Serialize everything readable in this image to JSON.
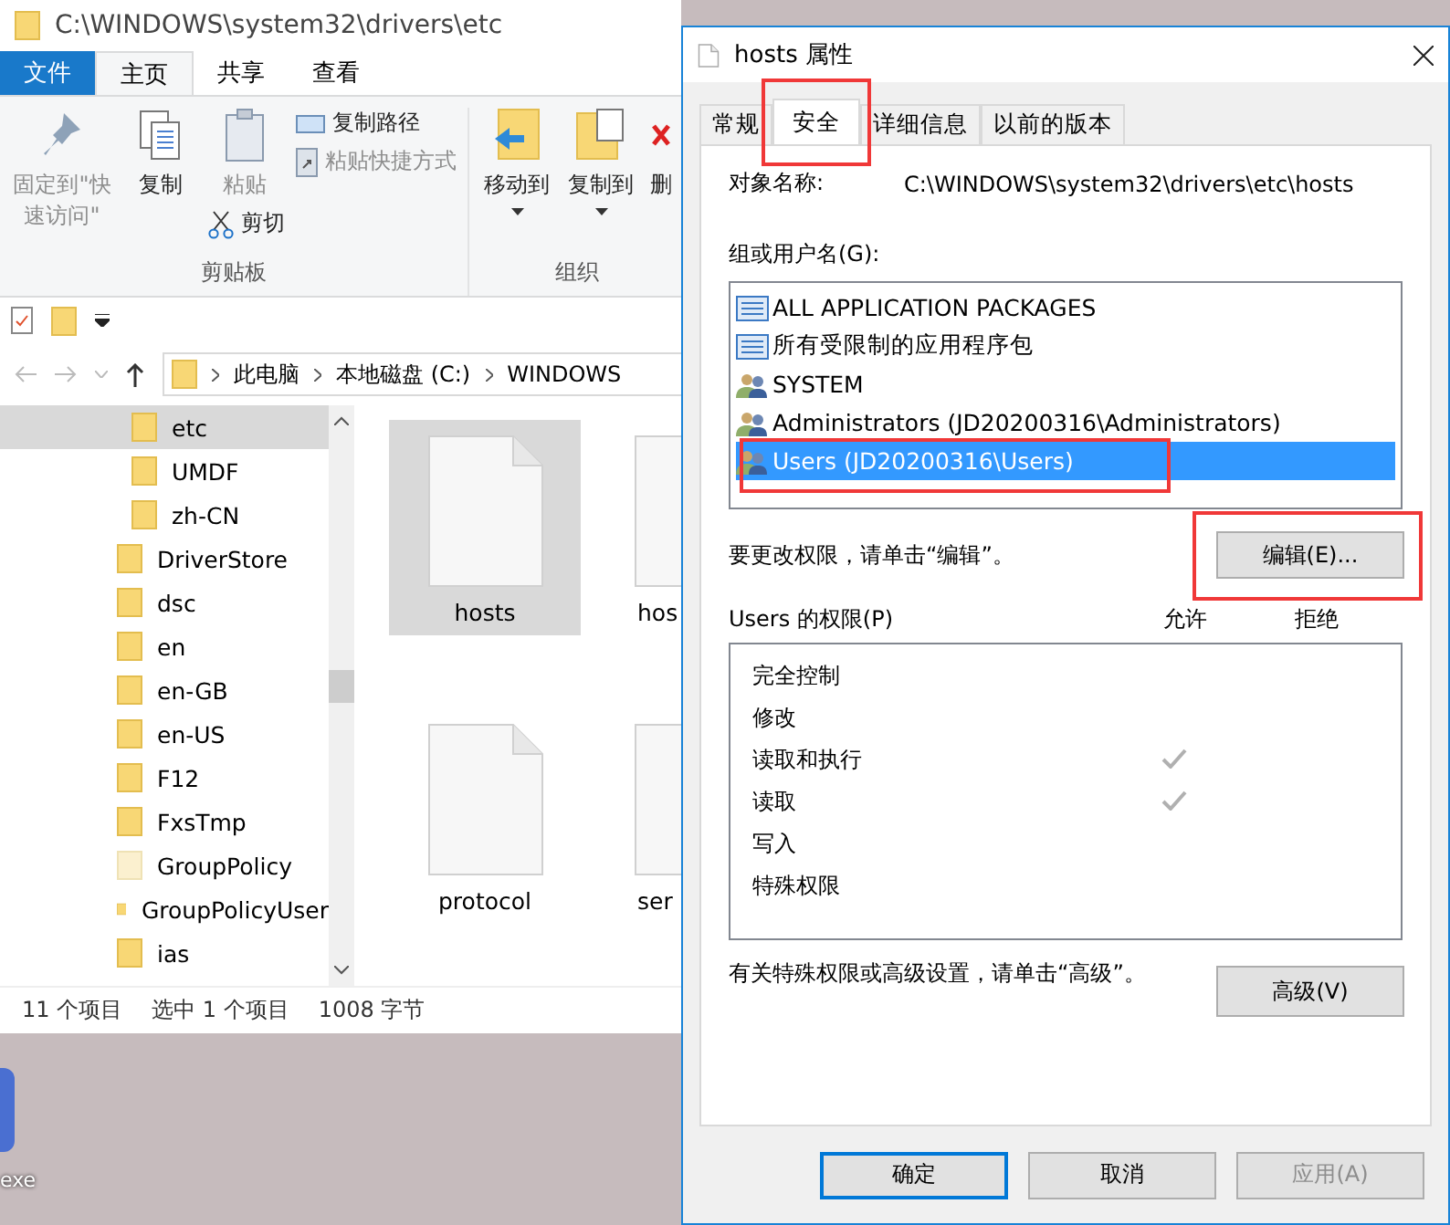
{
  "explorer": {
    "title": "C:\\WINDOWS\\system32\\drivers\\etc",
    "ribbon_tabs": [
      {
        "label": "文件",
        "kind": "file",
        "selected": false
      },
      {
        "label": "主页",
        "kind": "tab",
        "selected": true
      },
      {
        "label": "共享",
        "kind": "tab",
        "selected": false
      },
      {
        "label": "查看",
        "kind": "tab",
        "selected": false
      }
    ],
    "ribbon_groups": [
      {
        "label": "剪贴板",
        "commands": [
          {
            "label": "固定到\"快速访问\"",
            "kind": "pin",
            "disabled": true
          },
          {
            "label": "复制",
            "kind": "copy",
            "disabled": false
          },
          {
            "label": "粘贴",
            "kind": "paste",
            "disabled": true
          },
          {
            "label": "复制路径",
            "kind": "copy-path",
            "disabled": false
          },
          {
            "label": "粘贴快捷方式",
            "kind": "paste-shortcut",
            "disabled": true
          },
          {
            "label": "剪切",
            "kind": "cut",
            "disabled": false
          }
        ]
      },
      {
        "label": "组织",
        "commands": [
          {
            "label": "移动到",
            "kind": "move-to",
            "disabled": false
          },
          {
            "label": "复制到",
            "kind": "copy-to",
            "disabled": false
          },
          {
            "label": "删",
            "kind": "delete",
            "disabled": false
          }
        ]
      }
    ],
    "breadcrumb": [
      "此电脑",
      "本地磁盘 (C:)",
      "WINDOWS"
    ],
    "tree": [
      {
        "children": [
          {
            "label": "etc",
            "selected": true,
            "hidden": false
          },
          {
            "label": "UMDF",
            "selected": false,
            "hidden": false
          },
          {
            "label": "zh-CN",
            "selected": false,
            "hidden": false
          }
        ]
      },
      {
        "label": "DriverStore",
        "selected": false,
        "hidden": false
      },
      {
        "label": "dsc",
        "selected": false,
        "hidden": false
      },
      {
        "label": "en",
        "selected": false,
        "hidden": false
      },
      {
        "label": "en-GB",
        "selected": false,
        "hidden": false
      },
      {
        "label": "en-US",
        "selected": false,
        "hidden": false
      },
      {
        "label": "F12",
        "selected": false,
        "hidden": false
      },
      {
        "label": "FxsTmp",
        "selected": false,
        "hidden": false
      },
      {
        "label": "GroupPolicy",
        "selected": false,
        "hidden": true
      },
      {
        "label": "GroupPolicyUser",
        "selected": false,
        "hidden": false
      },
      {
        "label": "ias",
        "selected": false,
        "hidden": false
      }
    ],
    "files": [
      {
        "name": "hosts",
        "selected": true
      },
      {
        "name": "hos",
        "selected": false
      },
      {
        "name": "protocol",
        "selected": false
      },
      {
        "name": "ser",
        "selected": false
      }
    ],
    "status_bar": [
      "11 个项目",
      "选中 1 个项目",
      "1008 字节"
    ]
  },
  "desktop": {
    "icon_label": "exe"
  },
  "dialog": {
    "title": "hosts 属性",
    "tabs": [
      {
        "label": "常规",
        "selected": false
      },
      {
        "label": "安全",
        "selected": true
      },
      {
        "label": "详细信息",
        "selected": false
      },
      {
        "label": "以前的版本",
        "selected": false
      }
    ],
    "object_label": "对象名称:",
    "object_name": "C:\\WINDOWS\\system32\\drivers\\etc\\hosts",
    "groups_label": "组或用户名(G):",
    "groups": [
      {
        "name": "ALL APPLICATION PACKAGES",
        "kind": "package",
        "selected": false
      },
      {
        "name": "所有受限制的应用程序包",
        "kind": "package",
        "selected": false
      },
      {
        "name": "SYSTEM",
        "kind": "group",
        "selected": false
      },
      {
        "name": "Administrators (JD20200316\\Administrators)",
        "kind": "group",
        "selected": false
      },
      {
        "name": "Users (JD20200316\\Users)",
        "kind": "group",
        "selected": true
      }
    ],
    "edit_hint": "要更改权限，请单击“编辑”。",
    "edit_button": "编辑(E)...",
    "permissions_label": "Users 的权限(P)",
    "allow_label": "允许",
    "deny_label": "拒绝",
    "permissions": [
      {
        "name": "完全控制",
        "allow": false,
        "deny": false
      },
      {
        "name": "修改",
        "allow": false,
        "deny": false
      },
      {
        "name": "读取和执行",
        "allow": true,
        "deny": false
      },
      {
        "name": "读取",
        "allow": true,
        "deny": false
      },
      {
        "name": "写入",
        "allow": false,
        "deny": false
      },
      {
        "name": "特殊权限",
        "allow": false,
        "deny": false
      }
    ],
    "advanced_hint": "有关特殊权限或高级设置，请单击“高级”。",
    "advanced_button": "高级(V)",
    "buttons": [
      {
        "label": "确定",
        "kind": "default",
        "disabled": false
      },
      {
        "label": "取消",
        "kind": "normal",
        "disabled": false
      },
      {
        "label": "应用(A)",
        "kind": "normal",
        "disabled": true
      }
    ]
  }
}
